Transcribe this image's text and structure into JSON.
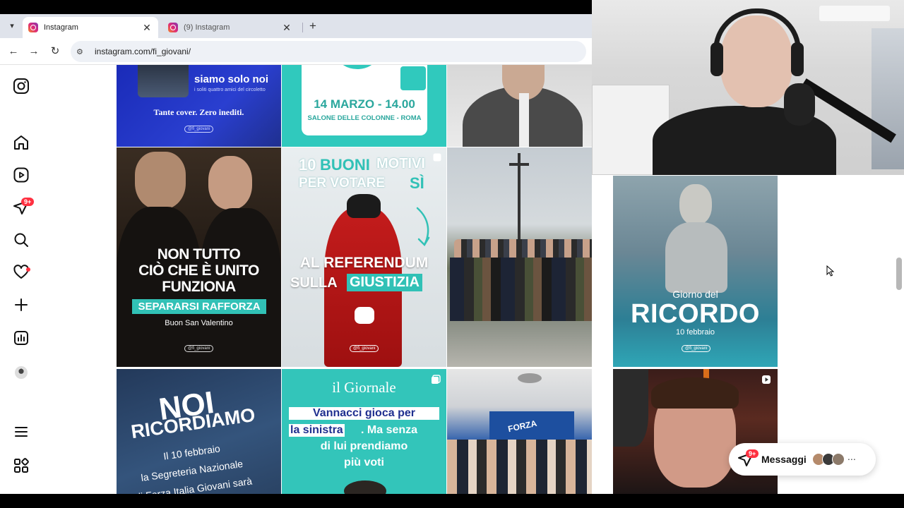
{
  "browser": {
    "tabs": [
      {
        "title": "Instagram",
        "active": true
      },
      {
        "title": "(9) Instagram",
        "active": false
      }
    ],
    "new_tab_label": "+",
    "url": "instagram.com/fi_giovani/"
  },
  "sidebar": {
    "notifications_badge": "9+"
  },
  "posts": {
    "row1": {
      "p1_title": "siamo solo noi",
      "p1_sub": "i soliti quattro amici del circoletto",
      "p1_tag": "Tante cover. Zero inediti.",
      "p1_handle": "@fi_giovani",
      "p2_date": "14 MARZO - 14.00",
      "p2_place": "SALONE DELLE COLONNE - ROMA"
    },
    "row2": {
      "p1_l1": "NON TUTTO",
      "p1_l2": "CIÒ CHE È UNITO",
      "p1_l3": "FUNZIONA",
      "p1_banner": "SEPARARSI RAFFORZA",
      "p1_sub": "Buon San Valentino",
      "p1_handle": "@fi_giovani",
      "p2_num": "10",
      "p2_buoni": "BUONI",
      "p2_motivi": "MOTIVI",
      "p2_l2a": "PER VOTARE",
      "p2_l2b": "SÌ",
      "p2_l3": "AL REFERENDUM",
      "p2_l4a": "SULLA",
      "p2_l4b": "GIUSTIZIA",
      "p2_handle": "@fi_giovani",
      "p4_l1": "Giorno del",
      "p4_l2": "RICORDO",
      "p4_l3": "10 febbraio",
      "p4_handle": "@fi_giovani"
    },
    "row3": {
      "p1_l1": "NOI",
      "p1_l2": "RICORDIAMO",
      "p1_l3": "Il 10 febbraio",
      "p1_l4": "la Segreteria Nazionale",
      "p1_l5": "di Forza Italia Giovani sarà",
      "p2_brand": "il Giornale",
      "p2_l1": "Vannacci gioca per",
      "p2_l2a": "la sinistra",
      "p2_l2b": ". Ma senza",
      "p2_l3": "di lui prendiamo",
      "p2_l4": "più voti",
      "p3_banner": "FORZA"
    }
  },
  "messages": {
    "label": "Messaggi",
    "badge": "9+",
    "more": "⋯"
  },
  "colors": {
    "instagram_red": "#ff3040",
    "teal": "#2fc4b9",
    "navy": "#1f2f8f"
  }
}
